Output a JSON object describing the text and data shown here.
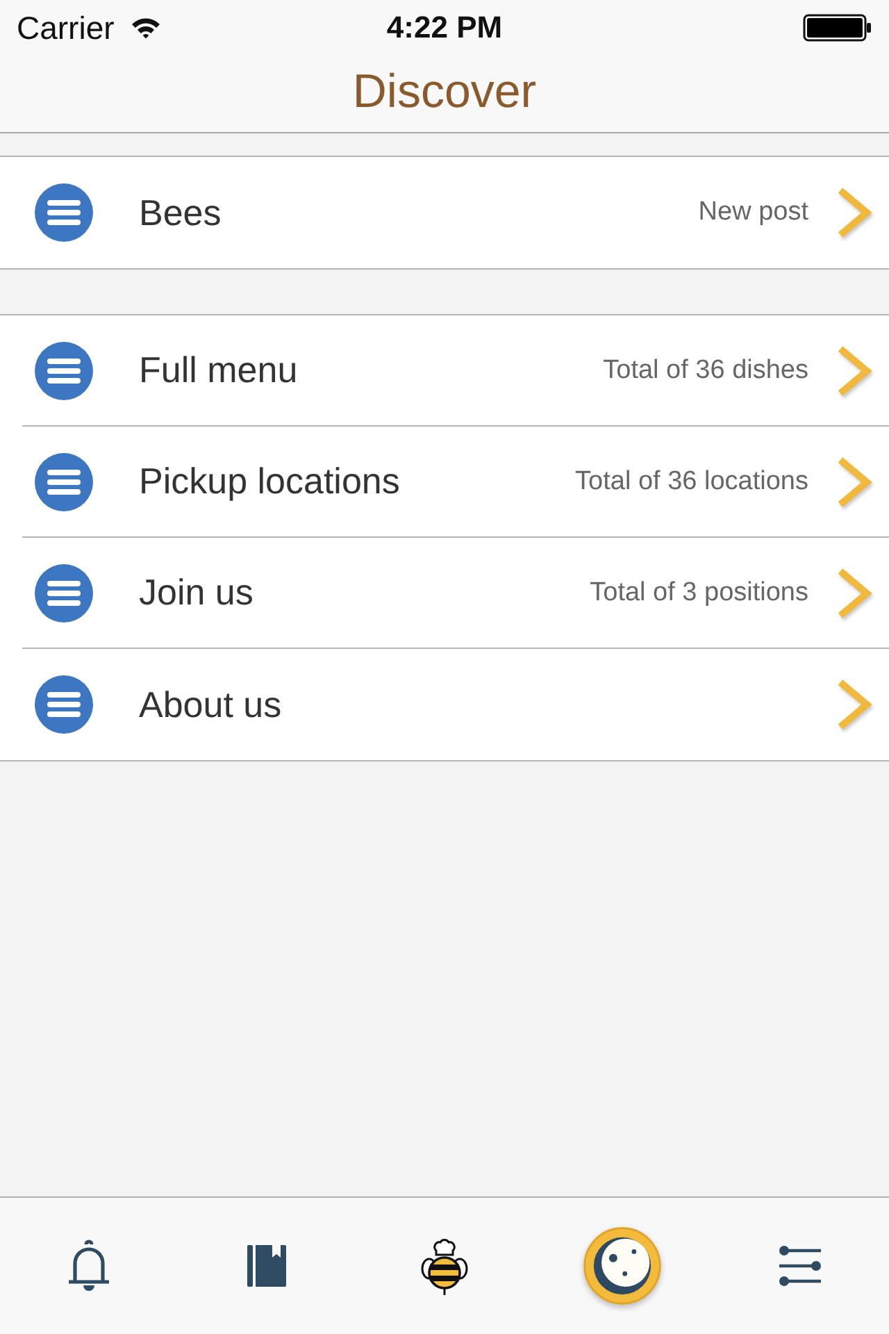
{
  "status_bar": {
    "carrier": "Carrier",
    "time": "4:22 PM"
  },
  "nav_bar": {
    "title": "Discover"
  },
  "sections": [
    {
      "items": [
        {
          "label": "Bees",
          "detail": "New post"
        }
      ]
    },
    {
      "items": [
        {
          "label": "Full menu",
          "detail": "Total of 36 dishes"
        },
        {
          "label": "Pickup locations",
          "detail": "Total of 36 locations"
        },
        {
          "label": "Join us",
          "detail": "Total of 3 positions"
        },
        {
          "label": "About us"
        }
      ]
    }
  ],
  "tab_bar": {
    "items": [
      {
        "kind": "bell"
      },
      {
        "kind": "book"
      },
      {
        "kind": "bee"
      },
      {
        "kind": "moon"
      },
      {
        "kind": "sliders"
      }
    ]
  }
}
